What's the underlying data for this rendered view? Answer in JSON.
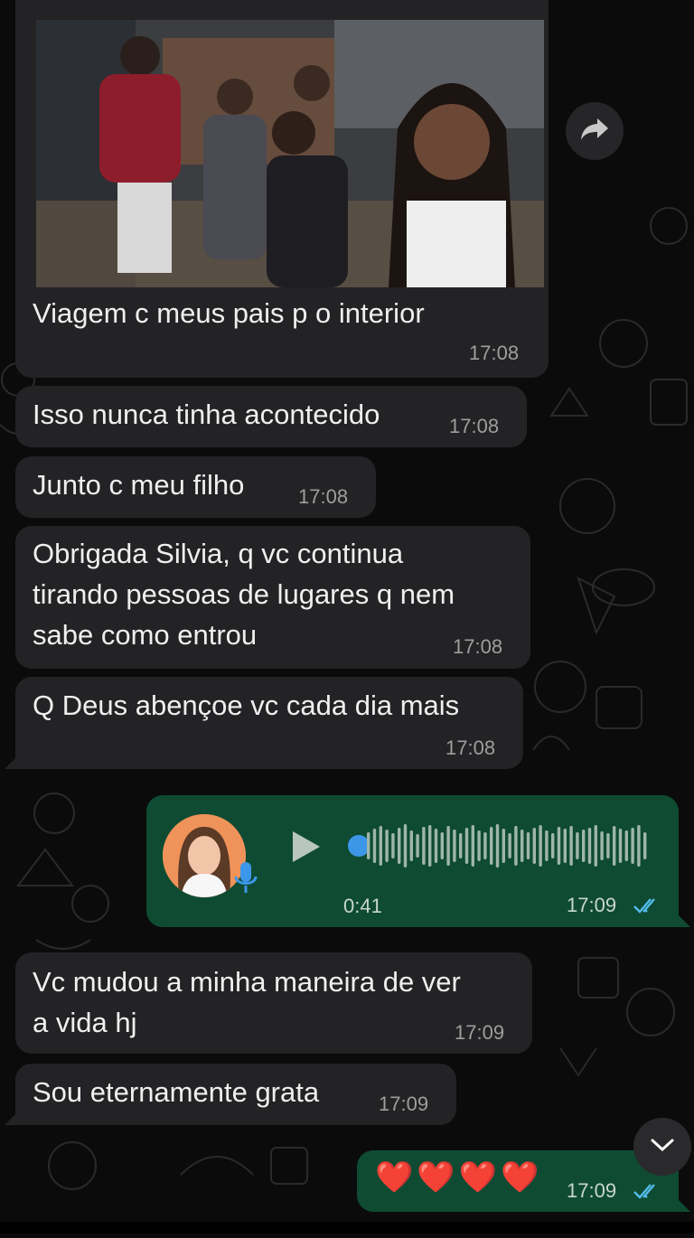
{
  "colors": {
    "background": "#0b0b0c",
    "incoming_bubble": "#232325",
    "outgoing_bubble": "#0f4b33",
    "read_ticks": "#53bdeb",
    "audio_dot": "#3d97e8",
    "heart": "#e0242f"
  },
  "icons": {
    "forward": "forward-arrow-icon",
    "play": "play-icon",
    "mic": "microphone-icon",
    "read": "double-check-icon",
    "scroll": "chevron-down-icon"
  },
  "messages": [
    {
      "text": "Viagem c meus pais p o interior",
      "time": "17:08"
    },
    {
      "text": "Isso nunca tinha acontecido",
      "time": "17:08"
    },
    {
      "text": "Junto c meu filho",
      "time": "17:08"
    },
    {
      "text": "Obrigada Silvia, q vc continua\ntirando pessoas de lugares q nem\nsabe como entrou",
      "time": "17:08"
    },
    {
      "text": "Q Deus abençoe vc cada dia mais",
      "time": "17:08"
    },
    {
      "text": "Vc mudou a minha maneira de ver\na vida hj",
      "time": "17:09"
    },
    {
      "text": "Sou eternamente grata",
      "time": "17:09"
    }
  ],
  "voice_note": {
    "duration": "0:41",
    "time": "17:09"
  },
  "hearts_message": {
    "text": "❤️❤️❤️❤️",
    "time": "17:09"
  }
}
